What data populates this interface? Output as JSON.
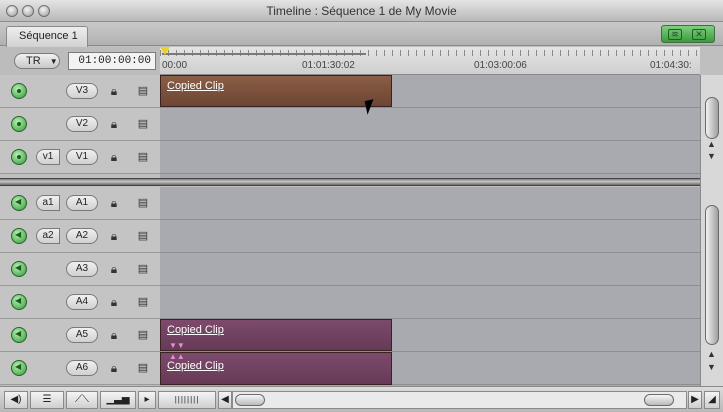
{
  "window": {
    "title": "Timeline : Séquence 1 de My Movie"
  },
  "tabs": [
    {
      "label": "Séquence 1"
    }
  ],
  "toolbar": {
    "mode_label": "TR",
    "timecode": "01:00:00:00"
  },
  "ruler": {
    "labels": [
      "00:00",
      "01:01:30:02",
      "01:03:00:06",
      "01:04:30:"
    ]
  },
  "video_tracks": [
    {
      "dest": "V3",
      "src": "",
      "clip": "Copied Clip"
    },
    {
      "dest": "V2",
      "src": "",
      "clip": ""
    },
    {
      "dest": "V1",
      "src": "v1",
      "clip": ""
    }
  ],
  "audio_tracks": [
    {
      "dest": "A1",
      "src": "a1",
      "clip": ""
    },
    {
      "dest": "A2",
      "src": "a2",
      "clip": ""
    },
    {
      "dest": "A3",
      "src": "",
      "clip": ""
    },
    {
      "dest": "A4",
      "src": "",
      "clip": ""
    },
    {
      "dest": "A5",
      "src": "",
      "clip": "Copied Clip"
    },
    {
      "dest": "A6",
      "src": "",
      "clip": "Copied Clip"
    }
  ],
  "colors": {
    "video_clip": "#7a5039",
    "audio_clip": "#6e3f5f",
    "playhead": "#e8d22a"
  },
  "icons": {
    "lock": "lock-icon",
    "visibility": "track-visibility-icon",
    "power": "track-power-icon"
  }
}
